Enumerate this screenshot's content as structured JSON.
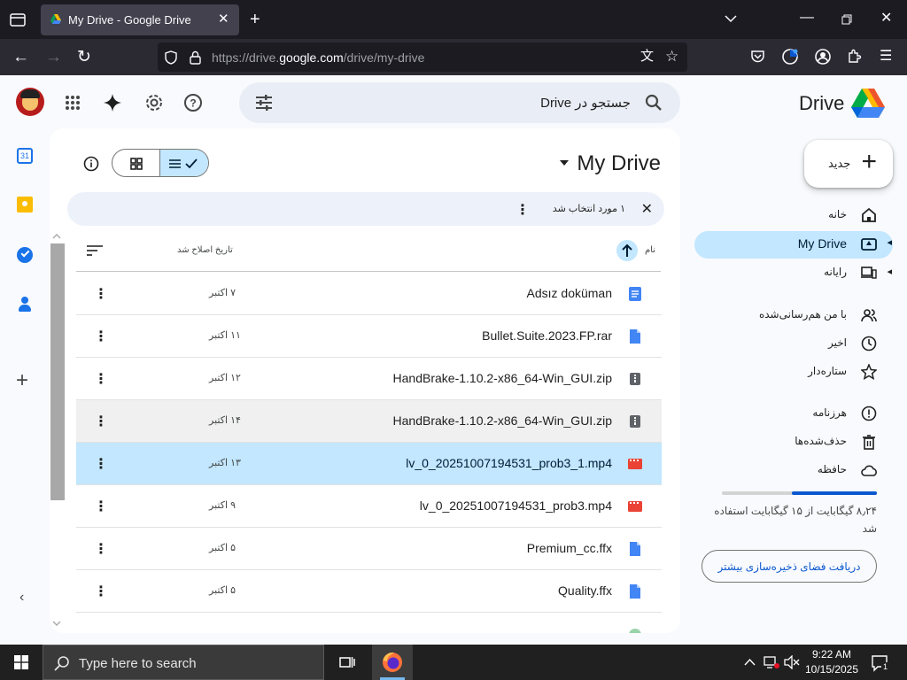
{
  "browser": {
    "tab_title": "My Drive - Google Drive",
    "url_prefix": "https://drive.",
    "url_domain": "google.com",
    "url_path": "/drive/my-drive"
  },
  "header": {
    "app_name": "Drive",
    "search_placeholder": "جستجو در Drive"
  },
  "sidebar": {
    "new_button": "جدید",
    "items": [
      {
        "label": "خانه",
        "icon": "home-icon"
      },
      {
        "label": "My Drive",
        "icon": "my-drive-icon",
        "active": true
      },
      {
        "label": "رایانه",
        "icon": "computers-icon"
      },
      {
        "label": "با من هم‌رسانی‌شده",
        "icon": "shared-icon"
      },
      {
        "label": "اخیر",
        "icon": "clock-icon"
      },
      {
        "label": "ستاره‌دار",
        "icon": "star-icon"
      },
      {
        "label": "هرزنامه",
        "icon": "spam-icon"
      },
      {
        "label": "حذف‌شده‌ها",
        "icon": "trash-icon"
      },
      {
        "label": "حافظه",
        "icon": "cloud-icon"
      }
    ],
    "storage": {
      "used_text": "۸٫۲۴ گیگابایت از ۱۵ گیگابایت استفاده شد",
      "used_fraction": 0.55,
      "button": "دریافت فضای ذخیره‌سازی بیشتر"
    }
  },
  "main": {
    "title": "My Drive",
    "selection_text": "۱ مورد انتخاب شد",
    "columns": {
      "name": "نام",
      "date": "تاریخ اصلاح شد"
    },
    "rows": [
      {
        "name": "Adsız doküman",
        "date": "۷ اکتبر",
        "type": "doc"
      },
      {
        "name": "Bullet.Suite.2023.FP.rar",
        "date": "۱۱ اکتبر",
        "type": "file"
      },
      {
        "name": "HandBrake-1.10.2-x86_64-Win_GUI.zip",
        "date": "۱۲ اکتبر",
        "type": "zip"
      },
      {
        "name": "HandBrake-1.10.2-x86_64-Win_GUI.zip",
        "date": "۱۴ اکتبر",
        "type": "zip",
        "hover": true
      },
      {
        "name": "lv_0_20251007194531_prob3_1.mp4",
        "date": "۱۳ اکتبر",
        "type": "video",
        "selected": true
      },
      {
        "name": "lv_0_20251007194531_prob3.mp4",
        "date": "۹ اکتبر",
        "type": "video"
      },
      {
        "name": "Premium_cc.ffx",
        "date": "۵ اکتبر",
        "type": "file"
      },
      {
        "name": "Quality.ffx",
        "date": "۵ اکتبر",
        "type": "file"
      }
    ]
  },
  "taskbar": {
    "search_placeholder": "Type here to search",
    "time": "9:22 AM",
    "date": "10/15/2025",
    "notification_count": "1"
  },
  "colors": {
    "accent": "#0b57d0",
    "selected": "#c2e7ff",
    "video_red": "#ea4335",
    "doc_blue": "#4285f4"
  }
}
